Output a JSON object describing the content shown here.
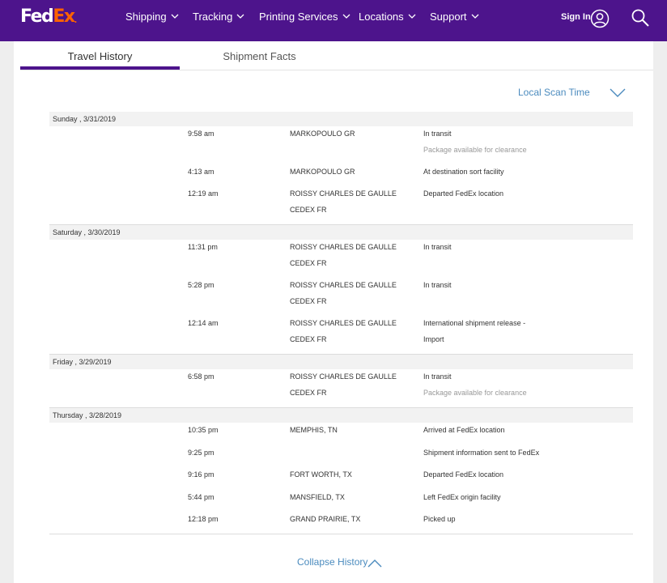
{
  "header": {
    "logo_fed": "Fed",
    "logo_ex": "Ex",
    "logo_dot": ".",
    "nav": [
      {
        "label": "Shipping"
      },
      {
        "label": "Tracking"
      },
      {
        "label": "Printing Services"
      },
      {
        "label": "Locations"
      },
      {
        "label": "Support"
      }
    ],
    "sign_in": "Sign In",
    "brand_color": "#4d148c",
    "accent_color": "#ff6200"
  },
  "tabs": [
    {
      "label": "Travel History",
      "active": true
    },
    {
      "label": "Shipment Facts",
      "active": false
    }
  ],
  "scan_time_label": "Local Scan Time",
  "days": [
    {
      "date": "Sunday , 3/31/2019",
      "events": [
        {
          "time": "9:58 am",
          "location": "MARKOPOULO GR",
          "status": "In transit",
          "sub": "Package available for clearance"
        },
        {
          "time": "4:13 am",
          "location": "MARKOPOULO GR",
          "status": "At destination sort facility"
        },
        {
          "time": "12:19 am",
          "location": "ROISSY CHARLES DE GAULLE CEDEX FR",
          "status": "Departed FedEx location"
        }
      ]
    },
    {
      "date": "Saturday , 3/30/2019",
      "events": [
        {
          "time": "11:31 pm",
          "location": "ROISSY CHARLES DE GAULLE CEDEX FR",
          "status": "In transit"
        },
        {
          "time": "5:28 pm",
          "location": "ROISSY CHARLES DE GAULLE CEDEX FR",
          "status": "In transit"
        },
        {
          "time": "12:14 am",
          "location": "ROISSY CHARLES DE GAULLE CEDEX FR",
          "status": "International shipment release - Import"
        }
      ]
    },
    {
      "date": "Friday , 3/29/2019",
      "events": [
        {
          "time": "6:58 pm",
          "location": "ROISSY CHARLES DE GAULLE CEDEX FR",
          "status": "In transit",
          "sub": "Package available for clearance"
        }
      ]
    },
    {
      "date": "Thursday , 3/28/2019",
      "events": [
        {
          "time": "10:35 pm",
          "location": "MEMPHIS, TN",
          "status": "Arrived at FedEx location"
        },
        {
          "time": "9:25 pm",
          "location": "",
          "status": "Shipment information sent to FedEx"
        },
        {
          "time": "9:16 pm",
          "location": "FORT WORTH, TX",
          "status": "Departed FedEx location"
        },
        {
          "time": "5:44 pm",
          "location": "MANSFIELD, TX",
          "status": "Left FedEx origin facility"
        },
        {
          "time": "12:18 pm",
          "location": "GRAND PRAIRIE, TX",
          "status": "Picked up"
        }
      ]
    }
  ],
  "collapse_label": "Collapse History"
}
